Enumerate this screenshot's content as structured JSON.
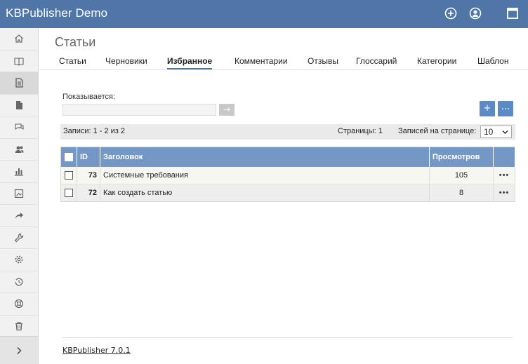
{
  "app": {
    "title": "KBPublisher Demo"
  },
  "topbar": {
    "icons": [
      "add-circle-icon",
      "user-icon",
      "window-icon"
    ]
  },
  "sidebar": {
    "items": [
      {
        "icon": "home-icon"
      },
      {
        "icon": "book-icon"
      },
      {
        "icon": "article-icon",
        "active": true
      },
      {
        "icon": "file-icon"
      },
      {
        "icon": "chat-icon"
      },
      {
        "icon": "users-icon"
      },
      {
        "icon": "chart-icon"
      },
      {
        "icon": "picture-icon"
      },
      {
        "icon": "share-icon"
      },
      {
        "icon": "wrench-icon"
      },
      {
        "icon": "gear-icon"
      },
      {
        "icon": "clock-icon"
      },
      {
        "icon": "lifebuoy-icon"
      },
      {
        "icon": "trash-icon"
      }
    ],
    "expand_icon": "chevron-right-icon"
  },
  "page": {
    "title": "Статьи"
  },
  "tabs": [
    {
      "label": "Статьи"
    },
    {
      "label": "Черновики"
    },
    {
      "label": "Избранное",
      "active": true
    },
    {
      "label": "Комментарии"
    },
    {
      "label": "Отзывы"
    },
    {
      "label": "Глоссарий"
    },
    {
      "label": "Категории"
    },
    {
      "label": "Шаблон"
    }
  ],
  "filter": {
    "label": "Показывается:",
    "value": "",
    "go_label": "→"
  },
  "actions": {
    "add_label": "+",
    "more_label": "..."
  },
  "pager": {
    "records": "Записи: 1 - 2 из 2",
    "pages": "Страницы: 1",
    "per_page_label": "Записей на странице:",
    "per_page_value": "10"
  },
  "table": {
    "headers": {
      "id": "ID",
      "title": "Заголовок",
      "views": "Просмотров"
    },
    "rows": [
      {
        "id": "73",
        "title": "Системные требования",
        "views": "105"
      },
      {
        "id": "72",
        "title": "Как создать статью",
        "views": "8"
      }
    ],
    "row_menu": "•••"
  },
  "footer": {
    "version": "KBPublisher 7.0.1"
  },
  "colors": {
    "header": "#4f76a6",
    "table_header": "#7398c6",
    "button": "#5b8ac4"
  }
}
